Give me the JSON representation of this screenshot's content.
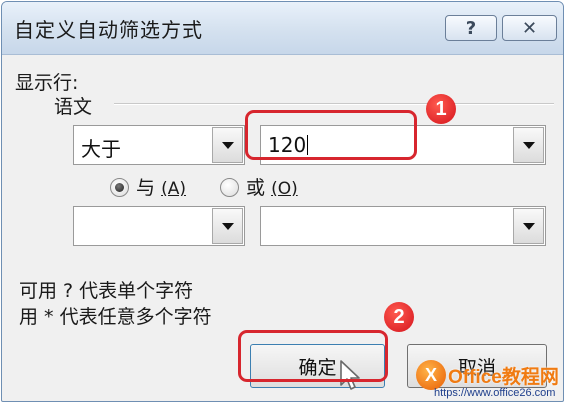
{
  "window": {
    "title": "自定义自动筛选方式"
  },
  "titlebar": {
    "help_glyph": "?",
    "close_glyph": "✕"
  },
  "icons": {
    "help": "help-icon",
    "close": "close-icon",
    "dropdown": "chevron-down-icon",
    "cursor": "mouse-pointer-icon"
  },
  "labels": {
    "show_rows": "显示行:",
    "field_name": "语文"
  },
  "row1": {
    "operator": "大于",
    "value": "120"
  },
  "logic": {
    "and": {
      "text": "与",
      "key": "(A)",
      "checked": true
    },
    "or": {
      "text": "或",
      "key": "(O)",
      "checked": false
    }
  },
  "row2": {
    "operator": "",
    "value": ""
  },
  "hints": {
    "line1": "可用 ? 代表单个字符",
    "line2": "用 * 代表任意多个字符"
  },
  "buttons": {
    "ok": "确定",
    "cancel": "取消"
  },
  "annotations": {
    "step1": "1",
    "step2": "2",
    "highlight_color": "#d7262e"
  },
  "watermark": {
    "logo": "X",
    "text": "Office教程网",
    "url": "https://www.office26.com"
  }
}
